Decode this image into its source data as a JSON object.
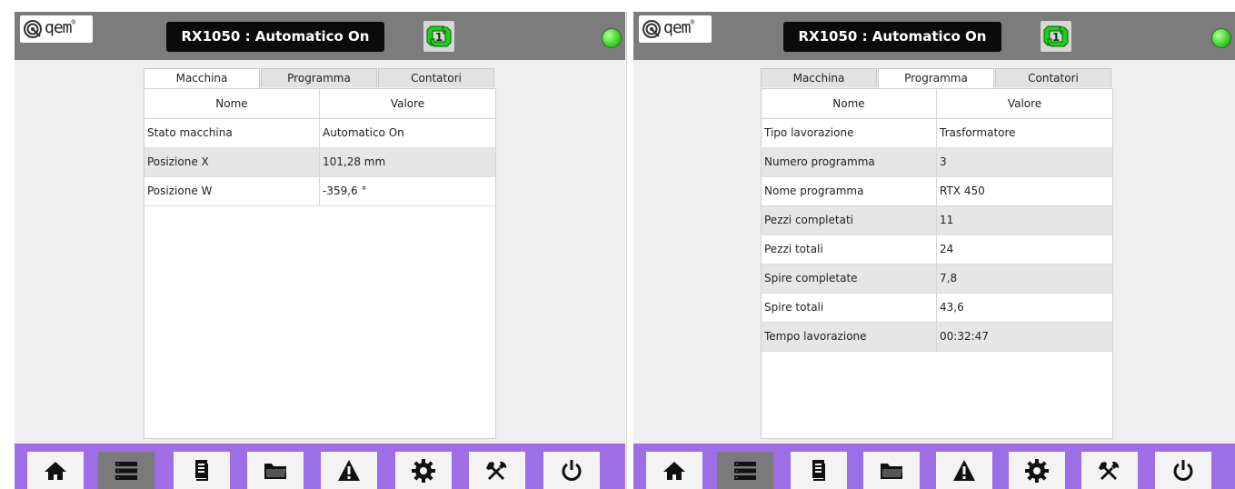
{
  "header": {
    "logo_text": "qem",
    "logo_reg": "®",
    "title": "RX1050 : Automatico On",
    "auto_icon": "auto-cycle-icon",
    "status_led_color": "#3cd82a"
  },
  "tabs": [
    "Macchina",
    "Programma",
    "Contatori"
  ],
  "table_headers": {
    "name": "Nome",
    "value": "Valore"
  },
  "left": {
    "active_tab": "Macchina",
    "rows": [
      {
        "name": "Stato macchina",
        "value": "Automatico On"
      },
      {
        "name": "Posizione X",
        "value": "101,28 mm"
      },
      {
        "name": "Posizione W",
        "value": "-359,6 °"
      }
    ]
  },
  "right": {
    "active_tab": "Programma",
    "rows": [
      {
        "name": "Tipo lavorazione",
        "value": "Trasformatore"
      },
      {
        "name": "Numero programma",
        "value": "3"
      },
      {
        "name": "Nome programma",
        "value": "RTX 450"
      },
      {
        "name": "Pezzi completati",
        "value": "11"
      },
      {
        "name": "Pezzi totali",
        "value": "24"
      },
      {
        "name": "Spire completate",
        "value": "7,8"
      },
      {
        "name": "Spire totali",
        "value": "43,6"
      },
      {
        "name": "Tempo lavorazione",
        "value": "00:32:47"
      }
    ]
  },
  "toolbar": {
    "buttons": [
      "home-icon",
      "list-icon",
      "document-icon",
      "folder-icon",
      "warning-icon",
      "gear-icon",
      "tools-icon",
      "power-icon"
    ],
    "active": "list-icon",
    "bar_color": "#9d6ee6"
  }
}
